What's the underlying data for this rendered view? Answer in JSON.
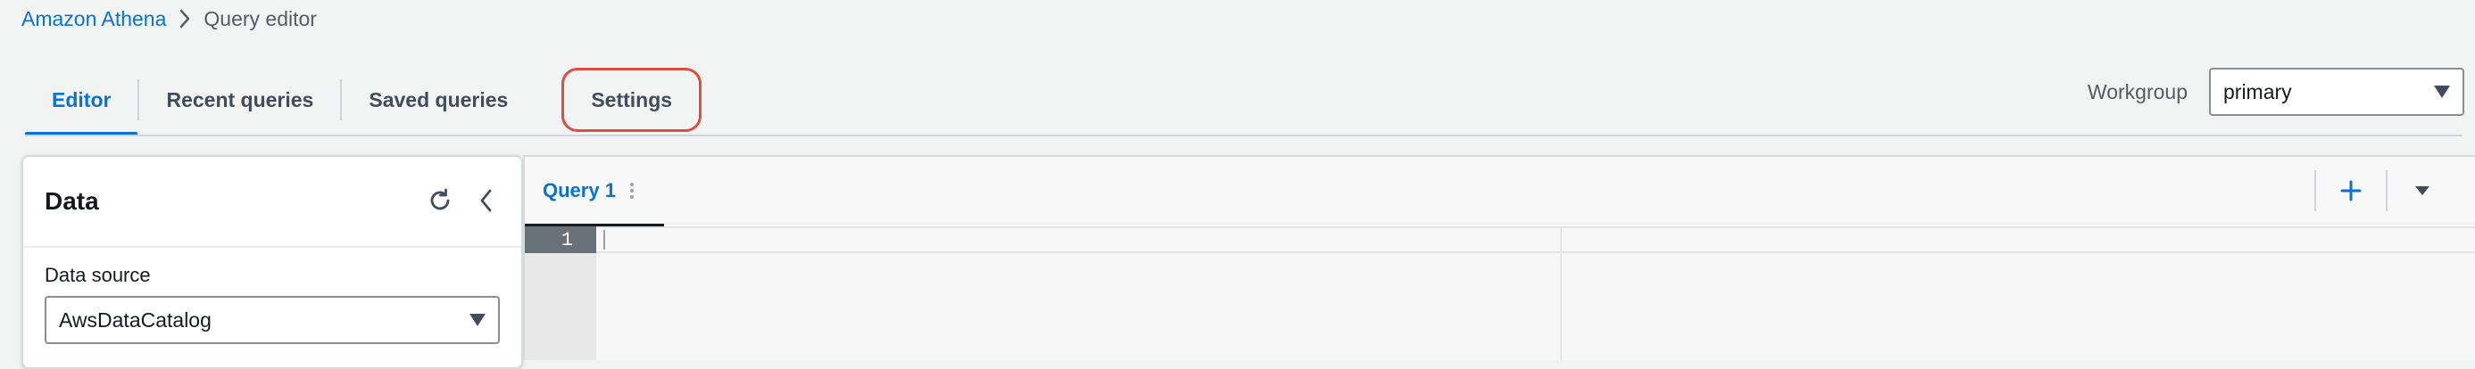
{
  "breadcrumb": {
    "parent": "Amazon Athena",
    "current": "Query editor"
  },
  "tabs": [
    {
      "label": "Editor",
      "active": true
    },
    {
      "label": "Recent queries",
      "active": false
    },
    {
      "label": "Saved queries",
      "active": false
    },
    {
      "label": "Settings",
      "active": false,
      "highlighted": true
    }
  ],
  "workgroup": {
    "label": "Workgroup",
    "value": "primary"
  },
  "data_panel": {
    "title": "Data",
    "data_source_label": "Data source",
    "data_source_value": "AwsDataCatalog"
  },
  "editor": {
    "query_tab_label": "Query 1",
    "line_number": "1"
  },
  "icons": {
    "breadcrumb_sep": "chevron-right-icon",
    "refresh": "refresh-icon",
    "collapse": "chevron-left-icon",
    "add": "plus-icon",
    "more": "caret-down-icon",
    "query_tab_menu": "kebab-icon"
  },
  "colors": {
    "accent": "#0972d3",
    "highlight_border": "#d9503f",
    "page_background": "#f2f3f3"
  }
}
